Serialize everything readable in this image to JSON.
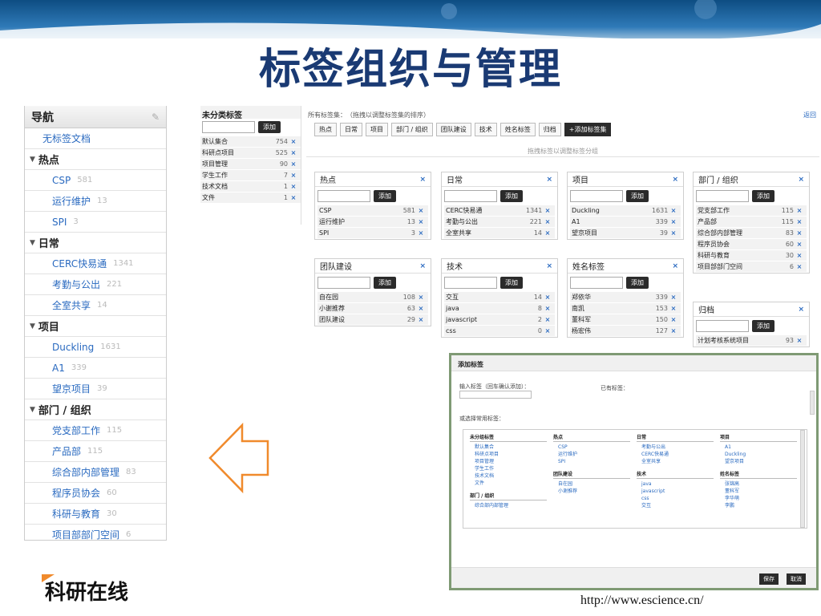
{
  "slide": {
    "title": "标签组织与管理",
    "logo_text": "科研在线",
    "url": "http://www.escience.cn/",
    "accent_color": "#1a3a73",
    "arrow_color": "#f08a2c"
  },
  "nav": {
    "title": "导航",
    "untagged": "无标签文档",
    "groups": [
      {
        "label": "热点",
        "items": [
          {
            "label": "CSP",
            "count": "581"
          },
          {
            "label": "运行维护",
            "count": "13"
          },
          {
            "label": "SPI",
            "count": "3"
          }
        ]
      },
      {
        "label": "日常",
        "items": [
          {
            "label": "CERC快易通",
            "count": "1341"
          },
          {
            "label": "考勤与公出",
            "count": "221"
          },
          {
            "label": "全室共享",
            "count": "14"
          }
        ]
      },
      {
        "label": "项目",
        "items": [
          {
            "label": "Duckling",
            "count": "1631"
          },
          {
            "label": "A1",
            "count": "339"
          },
          {
            "label": "望京项目",
            "count": "39"
          }
        ]
      },
      {
        "label": "部门 / 组织",
        "items": [
          {
            "label": "党支部工作",
            "count": "115"
          },
          {
            "label": "产品部",
            "count": "115"
          },
          {
            "label": "综合部内部管理",
            "count": "83"
          },
          {
            "label": "程序员协会",
            "count": "60"
          },
          {
            "label": "科研与教育",
            "count": "30"
          },
          {
            "label": "项目部部门空间",
            "count": "6"
          }
        ]
      }
    ]
  },
  "manager": {
    "uncategorized_title": "未分类标签",
    "add_label": "添加",
    "uncategorized": [
      {
        "name": "默认集合",
        "count": "754"
      },
      {
        "name": "科研点项目",
        "count": "525"
      },
      {
        "name": "项目管理",
        "count": "90"
      },
      {
        "name": "学生工作",
        "count": "7"
      },
      {
        "name": "技术文档",
        "count": "1"
      },
      {
        "name": "文件",
        "count": "1"
      }
    ],
    "all_sets_label": "所有标签集：　（拖拽以调整标签集的排序）",
    "back_label": "返回",
    "set_chips": [
      "热点",
      "日常",
      "项目",
      "部门 / 组织",
      "团队建设",
      "技术",
      "姓名标签",
      "归档"
    ],
    "add_set_label": "+添加标签集",
    "drag_hint": "拖拽标签以调整标签分组",
    "cards": [
      {
        "title": "热点",
        "tags": [
          {
            "name": "CSP",
            "count": "581"
          },
          {
            "name": "运行维护",
            "count": "13"
          },
          {
            "name": "SPI",
            "count": "3"
          }
        ]
      },
      {
        "title": "日常",
        "tags": [
          {
            "name": "CERC快易通",
            "count": "1341"
          },
          {
            "name": "考勤与公出",
            "count": "221"
          },
          {
            "name": "全室共享",
            "count": "14"
          }
        ]
      },
      {
        "title": "项目",
        "tags": [
          {
            "name": "Duckling",
            "count": "1631"
          },
          {
            "name": "A1",
            "count": "339"
          },
          {
            "name": "望京项目",
            "count": "39"
          }
        ]
      },
      {
        "title": "部门 / 组织",
        "tags": [
          {
            "name": "党支部工作",
            "count": "115"
          },
          {
            "name": "产品部",
            "count": "115"
          },
          {
            "name": "综合部内部管理",
            "count": "83"
          },
          {
            "name": "程序员协会",
            "count": "60"
          },
          {
            "name": "科研与教育",
            "count": "30"
          },
          {
            "name": "项目部部门空间",
            "count": "6"
          }
        ]
      },
      {
        "title": "团队建设",
        "tags": [
          {
            "name": "自在园",
            "count": "108"
          },
          {
            "name": "小谢推荐",
            "count": "63"
          },
          {
            "name": "团队建设",
            "count": "29"
          }
        ]
      },
      {
        "title": "技术",
        "tags": [
          {
            "name": "交互",
            "count": "14"
          },
          {
            "name": "java",
            "count": "8"
          },
          {
            "name": "javascript",
            "count": "2"
          },
          {
            "name": "css",
            "count": "0"
          }
        ]
      },
      {
        "title": "姓名标签",
        "tags": [
          {
            "name": "郑依华",
            "count": "339"
          },
          {
            "name": "南凯",
            "count": "153"
          },
          {
            "name": "董科军",
            "count": "150"
          },
          {
            "name": "杨宏伟",
            "count": "127"
          }
        ]
      },
      {
        "title": "归档",
        "tags": [
          {
            "name": "计划考核系统项目",
            "count": "93"
          }
        ]
      }
    ]
  },
  "dialog": {
    "title": "添加标签",
    "input_label": "输入标签（回车确认添加）：",
    "existing_label": "已有标签：",
    "choose_label": "或选择常用标签：",
    "columns": [
      {
        "groups": [
          {
            "title": "未分组标签",
            "items": [
              "默认集合",
              "科研点项目",
              "项目管理",
              "学生工作",
              "技术文档",
              "文件"
            ]
          },
          {
            "title": "部门 / 组织",
            "items": [
              "综合部内部管理"
            ]
          }
        ]
      },
      {
        "groups": [
          {
            "title": "热点",
            "items": [
              "CSP",
              "运行维护",
              "SPI"
            ]
          },
          {
            "title": "团队建设",
            "items": [
              "自在园",
              "小谢推荐"
            ]
          }
        ]
      },
      {
        "groups": [
          {
            "title": "日常",
            "items": [
              "考勤与公出",
              "CERC快易通",
              "全室共享"
            ]
          },
          {
            "title": "技术",
            "items": [
              "java",
              "javascript",
              "css",
              "交互"
            ]
          }
        ]
      },
      {
        "groups": [
          {
            "title": "项目",
            "items": [
              "A1",
              "Duckling",
              "望京项目"
            ]
          },
          {
            "title": "姓名标签",
            "items": [
              "张锦高",
              "董科军",
              "李华萌",
              "李鹏"
            ]
          }
        ]
      }
    ],
    "save_label": "保存",
    "cancel_label": "取消"
  }
}
